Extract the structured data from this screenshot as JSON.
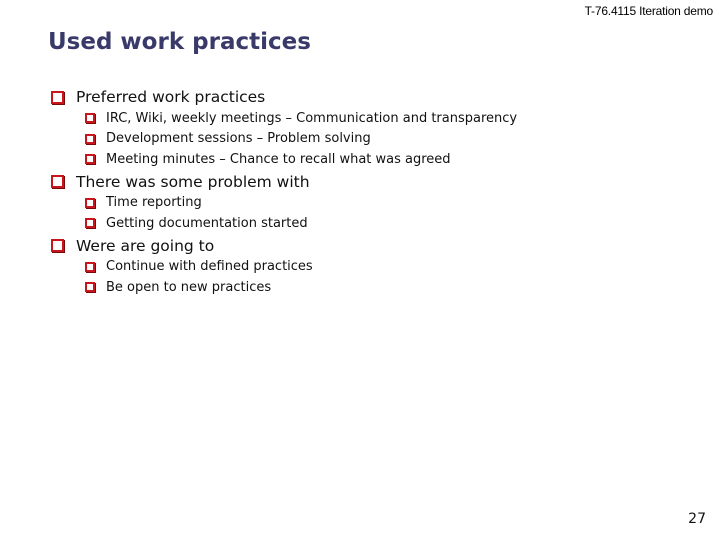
{
  "header": {
    "course": "T-76.4115 Iteration demo"
  },
  "slide": {
    "title": "Used work practices",
    "page_number": "27"
  },
  "bullets": [
    {
      "text": "Preferred work practices",
      "icon": "square-bullet-icon",
      "children": [
        {
          "text": "IRC, Wiki, weekly meetings – Communication and transparency",
          "icon": "square-bullet-icon"
        },
        {
          "text": "Development sessions – Problem solving",
          "icon": "square-bullet-icon"
        },
        {
          "text": "Meeting minutes – Chance to recall what was agreed",
          "icon": "square-bullet-icon"
        }
      ]
    },
    {
      "text": "There was some problem with",
      "icon": "square-bullet-icon",
      "children": [
        {
          "text": "Time reporting",
          "icon": "square-bullet-icon"
        },
        {
          "text": "Getting documentation started",
          "icon": "square-bullet-icon"
        }
      ]
    },
    {
      "text": "Were are going to",
      "icon": "square-bullet-icon",
      "children": [
        {
          "text": "Continue with defined practices",
          "icon": "square-bullet-icon"
        },
        {
          "text": "Be open to new practices",
          "icon": "square-bullet-icon"
        }
      ]
    }
  ],
  "colors": {
    "title": "#3a3a6a",
    "bullet": "#c8161d"
  }
}
